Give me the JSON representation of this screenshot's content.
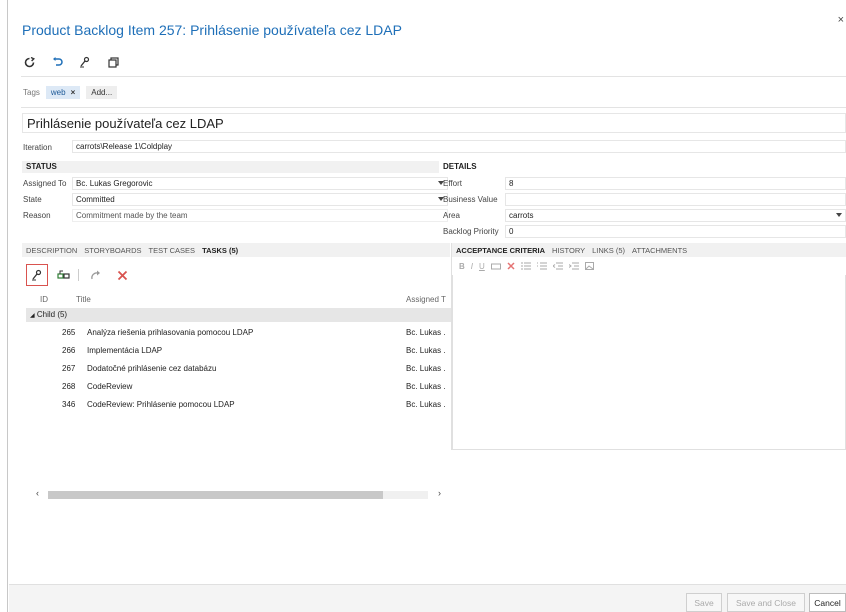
{
  "header": {
    "title": "Product Backlog Item 257: Prihlásenie používateľa cez LDAP",
    "close_glyph": "×"
  },
  "toolbar": {
    "icons": [
      "refresh-icon",
      "undo-icon",
      "new-linked-item-icon",
      "copy-icon"
    ]
  },
  "tags": {
    "label": "Tags",
    "items": [
      {
        "label": "web",
        "remove": "×"
      }
    ],
    "add_label": "Add..."
  },
  "work_item": {
    "title": "Prihlásenie používateľa cez LDAP",
    "iteration_label": "Iteration",
    "iteration_value": "carrots\\Release 1\\Coldplay"
  },
  "status": {
    "header": "STATUS",
    "assigned_to_label": "Assigned To",
    "assigned_to_value": "Bc. Lukas Gregorovic",
    "state_label": "State",
    "state_value": "Committed",
    "reason_label": "Reason",
    "reason_value": "Commitment made by the team"
  },
  "details": {
    "header": "DETAILS",
    "effort_label": "Effort",
    "effort_value": "8",
    "business_value_label": "Business Value",
    "business_value_value": "",
    "area_label": "Area",
    "area_value": "carrots",
    "backlog_priority_label": "Backlog Priority",
    "backlog_priority_value": "0"
  },
  "left_tabs": {
    "tabs": [
      "DESCRIPTION",
      "STORYBOARDS",
      "TEST CASES",
      "TASKS (5)"
    ],
    "active": "TASKS (5)"
  },
  "right_tabs": {
    "tabs": [
      "ACCEPTANCE CRITERIA",
      "HISTORY",
      "LINKS (5)",
      "ATTACHMENTS"
    ],
    "active": "ACCEPTANCE CRITERIA"
  },
  "tasks": {
    "columns": [
      "ID",
      "Title",
      "Assigned T"
    ],
    "group_label": "Child (5)",
    "rows": [
      {
        "id": "265",
        "title": "Analýza riešenia prihlasovania pomocou LDAP",
        "assigned": "Bc. Lukas ."
      },
      {
        "id": "266",
        "title": "Implementácia LDAP",
        "assigned": "Bc. Lukas ."
      },
      {
        "id": "267",
        "title": "Dodatočné prihlásenie cez databázu",
        "assigned": "Bc. Lukas ."
      },
      {
        "id": "268",
        "title": "CodeReview",
        "assigned": "Bc. Lukas ."
      },
      {
        "id": "346",
        "title": "CodeReview: Prihlásenie pomocou LDAP",
        "assigned": "Bc. Lukas ."
      }
    ]
  },
  "rte_toolbar": {
    "items": [
      "B",
      "I",
      "U"
    ]
  },
  "footer": {
    "save_label": "Save",
    "save_close_label": "Save and Close",
    "cancel_label": "Cancel"
  },
  "colors": {
    "title_blue": "#1e6fb8",
    "delete_red": "#d9534f",
    "tag_bg": "#dde9f6"
  }
}
